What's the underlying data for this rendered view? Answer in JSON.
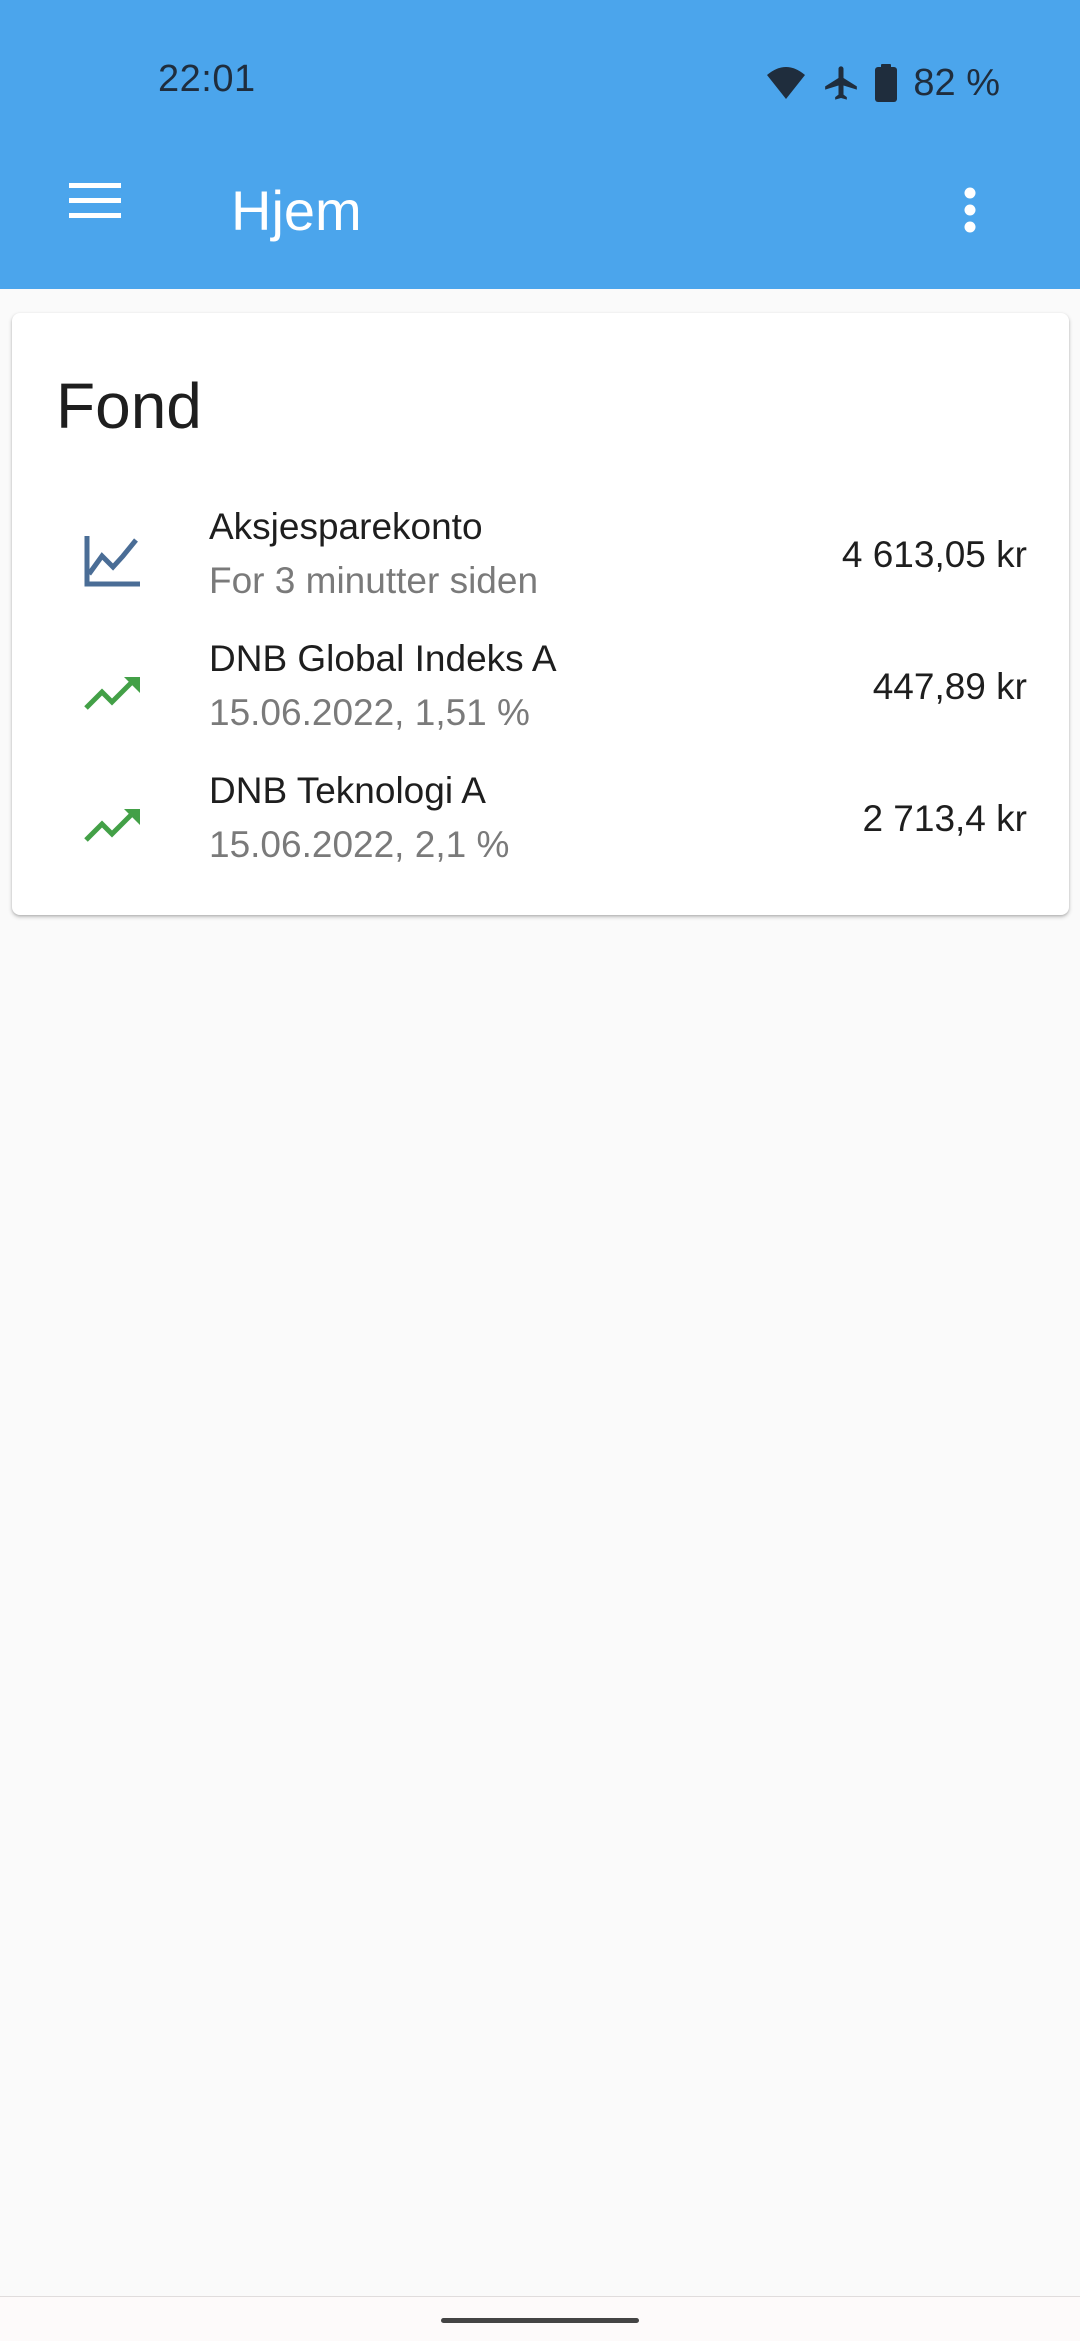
{
  "status_bar": {
    "time": "22:01",
    "battery_text": "82 %",
    "icons": [
      "wifi-icon",
      "airplane-icon",
      "battery-icon"
    ]
  },
  "app_bar": {
    "title": "Hjem",
    "menu_icon": "hamburger-menu-icon",
    "overflow_icon": "more-vert-icon",
    "background": "#4ba5ec"
  },
  "card": {
    "title": "Fond",
    "items": [
      {
        "name": "Aksjesparekonto",
        "subtitle": "For 3 minutter siden",
        "value": "4 613,05 kr",
        "icon": "line-chart-icon",
        "icon_color": "#4a6d96"
      },
      {
        "name": "DNB Global Indeks A",
        "subtitle": "15.06.2022, 1,51 %",
        "value": "447,89 kr",
        "icon": "trending-up-icon",
        "icon_color": "#43a047"
      },
      {
        "name": "DNB Teknologi A",
        "subtitle": "15.06.2022, 2,1 %",
        "value": "2 713,4 kr",
        "icon": "trending-up-icon",
        "icon_color": "#43a047"
      }
    ]
  }
}
